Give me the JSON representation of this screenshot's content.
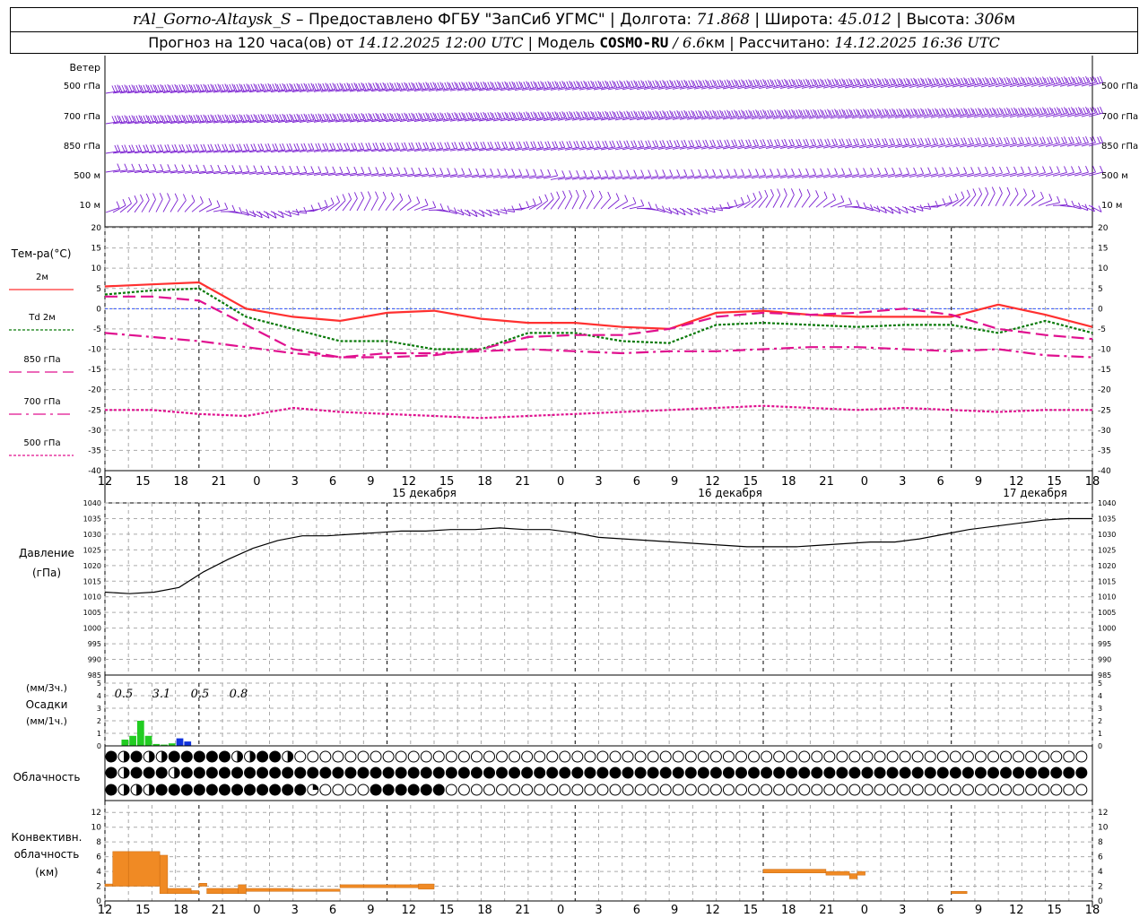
{
  "header": {
    "station": "rAl_Gorno-Altaysk_S",
    "provider": "– Предоставлено ФГБУ \"ЗапСиб УГМС\" |",
    "lon_label": "Долгота:",
    "lon_value": "71.868",
    "lat_label": "| Широта:",
    "lat_value": "45.012",
    "alt_label": "| Высота:",
    "alt_value": "306",
    "alt_unit": "м",
    "forecast_label": "Прогноз на 120 часа(ов) от",
    "init_time": "14.12.2025 12:00 UTC",
    "model_label": "| Модель",
    "model": "COSMO-RU",
    "model_res": "/ 6.6",
    "model_res_unit": "км",
    "calc_label": "| Рассчитано:",
    "calc_time": "14.12.2025 16:36 UTC"
  },
  "colors": {
    "wind": "#7a1fd1",
    "t2m": "#ff3030",
    "td2m": "#0a7a0a",
    "t850": "#e0108f",
    "t700": "#e0108f",
    "t500": "#e0108f",
    "pressure": "#000000",
    "precip3h": "#22cc22",
    "precip1h": "#1133dd",
    "convective": "#f08a24",
    "zeroline": "#3355ff"
  },
  "chart_data": [
    {
      "type": "wind_barbs",
      "title": "Ветер",
      "levels": [
        "500 гПа",
        "700 гПа",
        "850 гПа",
        "500 м",
        "10  м"
      ]
    },
    {
      "type": "line",
      "title": "Тем-ра(°C)",
      "ylim": [
        -40,
        20
      ],
      "yticks": [
        20,
        15,
        10,
        5,
        0,
        -5,
        -10,
        -15,
        -20,
        -25,
        -30,
        -35,
        -40
      ],
      "x_hours": [
        0,
        6,
        12,
        18,
        24,
        30,
        36,
        42,
        48,
        54,
        60,
        66,
        72,
        78,
        84,
        90,
        96,
        102,
        108,
        114,
        120
      ],
      "series": [
        {
          "name": "2м",
          "key": "t2m",
          "style": "solid",
          "values": [
            5.5,
            6,
            6.5,
            0,
            -2,
            -3,
            -1,
            -0.5,
            -2.5,
            -3.5,
            -3.5,
            -4.5,
            -5,
            -1,
            -0.5,
            -1.5,
            -2,
            -2,
            -2,
            1,
            -1.5,
            -4.5
          ]
        },
        {
          "name": "Td  2м",
          "key": "td2m",
          "style": "dotted",
          "values": [
            3.5,
            4.5,
            5,
            -2,
            -5,
            -8,
            -8,
            -10,
            -10,
            -6,
            -6,
            -8,
            -8.5,
            -4,
            -3.5,
            -4,
            -4.5,
            -4,
            -4,
            -6,
            -3,
            -6
          ]
        },
        {
          "name": "850 гПа",
          "key": "t850",
          "style": "dashed",
          "values": [
            3,
            3,
            2,
            -4,
            -10,
            -12,
            -12,
            -11.5,
            -10,
            -7,
            -6.5,
            -6.5,
            -5,
            -2,
            -1,
            -1.5,
            -1,
            0,
            -1.5,
            -5,
            -6.5,
            -7.5
          ]
        },
        {
          "name": "700 гПа",
          "key": "t700",
          "style": "dashdot",
          "values": [
            -6,
            -7,
            -8,
            -9.5,
            -11,
            -12,
            -11,
            -11,
            -10.5,
            -10,
            -10.5,
            -11,
            -10.5,
            -10.5,
            -10,
            -9.5,
            -9.5,
            -10,
            -10.5,
            -10,
            -11.5,
            -12
          ]
        },
        {
          "name": "500 гПа",
          "key": "t500",
          "style": "dotted",
          "values": [
            -25,
            -25,
            -26,
            -26.5,
            -24.5,
            -25.5,
            -26,
            -26.5,
            -27,
            -26.5,
            -26,
            -25.5,
            -25,
            -24.5,
            -24,
            -24.5,
            -25,
            -24.5,
            -25,
            -25.5,
            -25,
            -25
          ]
        }
      ]
    },
    {
      "type": "line",
      "title": "Давление",
      "ylabel": "(гПа)",
      "ylim": [
        985,
        1040
      ],
      "yticks": [
        1040,
        1035,
        1030,
        1025,
        1020,
        1015,
        1010,
        1005,
        1000,
        995,
        990,
        985
      ],
      "x_hours": [
        0,
        3,
        6,
        9,
        12,
        15,
        18,
        21,
        24,
        27,
        30,
        33,
        36,
        39,
        42,
        45,
        48,
        51,
        54,
        57,
        60,
        63,
        66,
        69,
        72,
        75,
        78,
        81,
        84,
        87,
        90,
        93,
        96,
        99,
        102,
        105,
        108,
        111,
        114,
        117,
        120
      ],
      "series": [
        {
          "name": "",
          "key": "pressure",
          "values": [
            1011.5,
            1011,
            1011.5,
            1013,
            1018,
            1022,
            1025.5,
            1028,
            1029.5,
            1029.5,
            1030,
            1030.5,
            1031,
            1031,
            1031.5,
            1031.5,
            1032,
            1031.5,
            1031.5,
            1030.5,
            1029,
            1028.5,
            1028,
            1027.5,
            1027,
            1026.5,
            1026,
            1026,
            1026,
            1026.5,
            1027,
            1027.5,
            1027.5,
            1028.5,
            1030,
            1031.5,
            1032.5,
            1033.5,
            1034.5,
            1035,
            1035
          ]
        }
      ]
    },
    {
      "type": "bar",
      "title": "Осадки",
      "ylabel_3h": "(мм/3ч.)",
      "ylabel_1h": "(мм/1ч.)",
      "ylim": [
        0,
        5
      ],
      "totals_3h": [
        "0.5",
        "3.1",
        "0.5",
        "0.8"
      ],
      "bars_3h": [
        {
          "hour": 2,
          "value": 0.5
        },
        {
          "hour": 3,
          "value": 0.8
        },
        {
          "hour": 4,
          "value": 2.0
        },
        {
          "hour": 5,
          "value": 0.8
        },
        {
          "hour": 6,
          "value": 0.15
        },
        {
          "hour": 7,
          "value": 0.1
        },
        {
          "hour": 8,
          "value": 0.2
        }
      ],
      "bars_1h": [
        {
          "hour": 9,
          "value": 0.6
        },
        {
          "hour": 10,
          "value": 0.35
        }
      ]
    },
    {
      "type": "cloud_symbols",
      "title": "Облачность",
      "note": "octa cover 0-8 per hour, three layers",
      "rows": [
        [
          8,
          4,
          8,
          4,
          4,
          8,
          8,
          8,
          8,
          8,
          6,
          4,
          8,
          8,
          6,
          0,
          0,
          0,
          0,
          0,
          0,
          0,
          0,
          0,
          0,
          0,
          0,
          0,
          0,
          0,
          0,
          0,
          0,
          0,
          0,
          0,
          0,
          0,
          0,
          0,
          0,
          0,
          0,
          0,
          0,
          0,
          0,
          0,
          0,
          0,
          0,
          0,
          0,
          0,
          0,
          0,
          0,
          0,
          0,
          0,
          0,
          0,
          0,
          0,
          0,
          0,
          0,
          0,
          0,
          0,
          0,
          0,
          0,
          0,
          0,
          0,
          0,
          0,
          0,
          0,
          0,
          0,
          0,
          0,
          0,
          0,
          0,
          0,
          0,
          0,
          0,
          0,
          0,
          0,
          0,
          0,
          0,
          0,
          0,
          0,
          0,
          0,
          0,
          0,
          0,
          0,
          0,
          0,
          0,
          0,
          0,
          0,
          0,
          0,
          0,
          0,
          0,
          0,
          0,
          0,
          0
        ],
        [
          8,
          6,
          8,
          8,
          8,
          4,
          8,
          8,
          8,
          8,
          8,
          8,
          8,
          8,
          8,
          8,
          8,
          8,
          8,
          8,
          8,
          8,
          8,
          8,
          8,
          8,
          8,
          8,
          8,
          8,
          8,
          8,
          8,
          8,
          8,
          8,
          8,
          8,
          8,
          8,
          8,
          8,
          8,
          8,
          8,
          8,
          8,
          8,
          8,
          8,
          8,
          8,
          8,
          8,
          8,
          8,
          8,
          8,
          8,
          8,
          8,
          8,
          8,
          8,
          8,
          8,
          8,
          8,
          8,
          8,
          8,
          8,
          8,
          8,
          8,
          8,
          8,
          8,
          8,
          8,
          8,
          8,
          8,
          8,
          8,
          8,
          8,
          8,
          8,
          8,
          8,
          8,
          8,
          8,
          8,
          8,
          8,
          8,
          8,
          8,
          8,
          8,
          8,
          8,
          8,
          8,
          8,
          8,
          8,
          8,
          8,
          8,
          8,
          8,
          8,
          8,
          8,
          8,
          8,
          8,
          8
        ],
        [
          8,
          6,
          4,
          4,
          8,
          8,
          8,
          8,
          8,
          8,
          8,
          8,
          8,
          8,
          8,
          8,
          2,
          0,
          0,
          0,
          0,
          8,
          8,
          8,
          8,
          8,
          8,
          0,
          0,
          0,
          0,
          0,
          0,
          0,
          0,
          0,
          0,
          0,
          0,
          0,
          0,
          0,
          0,
          0,
          0,
          0,
          0,
          0,
          0,
          0,
          0,
          0,
          0,
          0,
          0,
          0,
          0,
          0,
          0,
          0,
          0,
          0,
          0,
          0,
          0,
          0,
          0,
          0,
          0,
          0,
          0,
          0,
          0,
          0,
          0,
          0,
          0,
          0,
          0,
          0,
          0,
          0,
          0,
          0,
          0,
          0,
          0,
          0,
          0,
          0,
          0,
          0,
          0,
          0,
          0,
          0,
          0,
          0,
          0,
          0,
          0,
          0,
          0,
          0,
          0,
          0,
          0,
          0,
          0,
          0,
          0,
          0,
          0,
          0,
          0,
          0,
          0,
          0,
          0,
          0,
          0
        ]
      ]
    },
    {
      "type": "bar",
      "title": "Конвективн. облачность (км)",
      "ylim": [
        0,
        13
      ],
      "yticks": [
        12,
        10,
        8,
        6,
        4,
        2,
        0
      ],
      "segments": [
        {
          "h0": 0,
          "h1": 1,
          "base": 2.0,
          "top": 2.3
        },
        {
          "h0": 1,
          "h1": 3,
          "base": 2.0,
          "top": 6.7
        },
        {
          "h0": 3,
          "h1": 7,
          "base": 2.0,
          "top": 6.7
        },
        {
          "h0": 7,
          "h1": 8,
          "base": 1.0,
          "top": 6.2
        },
        {
          "h0": 8,
          "h1": 11,
          "base": 1.0,
          "top": 1.7
        },
        {
          "h0": 11,
          "h1": 12,
          "base": 1.0,
          "top": 1.4
        },
        {
          "h0": 12,
          "h1": 13,
          "base": 2.0,
          "top": 2.4
        },
        {
          "h0": 13,
          "h1": 15,
          "base": 1.0,
          "top": 1.7
        },
        {
          "h0": 15,
          "h1": 17,
          "base": 1.0,
          "top": 1.7
        },
        {
          "h0": 17,
          "h1": 18,
          "base": 1.0,
          "top": 2.2
        },
        {
          "h0": 18,
          "h1": 21,
          "base": 1.3,
          "top": 1.7
        },
        {
          "h0": 21,
          "h1": 24,
          "base": 1.3,
          "top": 1.7
        },
        {
          "h0": 24,
          "h1": 27,
          "base": 1.3,
          "top": 1.6
        },
        {
          "h0": 27,
          "h1": 30,
          "base": 1.3,
          "top": 1.6
        },
        {
          "h0": 30,
          "h1": 33,
          "base": 1.8,
          "top": 2.2
        },
        {
          "h0": 33,
          "h1": 37,
          "base": 1.8,
          "top": 2.2
        },
        {
          "h0": 37,
          "h1": 40,
          "base": 1.8,
          "top": 2.2
        },
        {
          "h0": 40,
          "h1": 42,
          "base": 1.6,
          "top": 2.3
        },
        {
          "h0": 84,
          "h1": 92,
          "base": 3.8,
          "top": 4.3
        },
        {
          "h0": 92,
          "h1": 95,
          "base": 3.5,
          "top": 4.0
        },
        {
          "h0": 95,
          "h1": 96,
          "base": 3.0,
          "top": 3.7
        },
        {
          "h0": 96,
          "h1": 97,
          "base": 3.5,
          "top": 4.0
        },
        {
          "h0": 108,
          "h1": 110,
          "base": 1.0,
          "top": 1.3
        }
      ]
    }
  ],
  "x_axis": {
    "tick_labels": [
      "12",
      "15",
      "18",
      "21",
      "0",
      "3",
      "6",
      "9",
      "12",
      "15",
      "18",
      "21",
      "0",
      "3",
      "6",
      "9",
      "12",
      "15",
      "18",
      "21",
      "0",
      "3",
      "6",
      "9",
      "12",
      "15",
      "18"
    ],
    "day_labels": [
      "15 декабря",
      "16 декабря",
      "17 декабря"
    ],
    "day_label_hours": [
      24,
      48,
      72
    ]
  }
}
